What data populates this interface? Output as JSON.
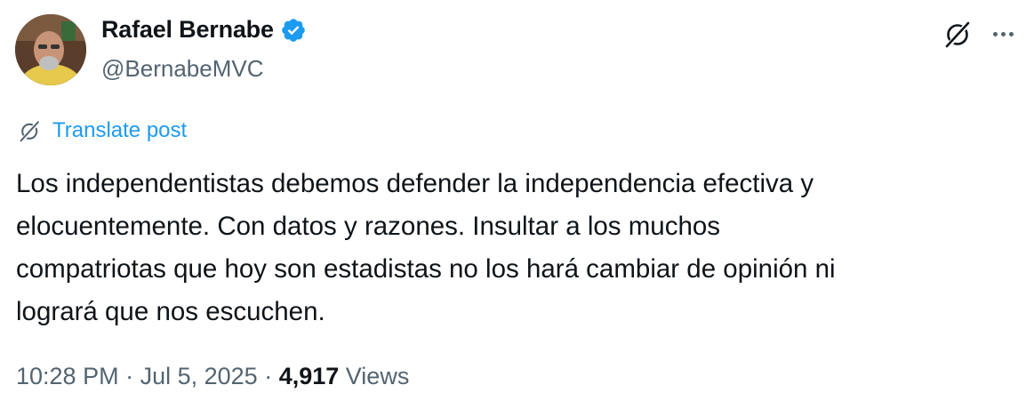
{
  "author": {
    "display_name": "Rafael Bernabe",
    "handle": "@BernabeMVC",
    "verified": true,
    "verified_color": "#1d9bf0"
  },
  "actions": {
    "grok_icon": "grok-icon",
    "more_icon": "more-icon"
  },
  "translate": {
    "label": "Translate post",
    "color": "#1d9bf0"
  },
  "post": {
    "text": "Los independentistas debemos defender la independencia efectiva y\nelocuentemente. Con datos y razones. Insultar a los muchos\ncompatriotas que hoy son estadistas no los hará cambiar de opinión ni\nlogrará que nos escuchen."
  },
  "meta": {
    "time": "10:28 PM",
    "separator": " · ",
    "date": "Jul 5, 2025",
    "views_count": "4,917",
    "views_label": "Views"
  }
}
